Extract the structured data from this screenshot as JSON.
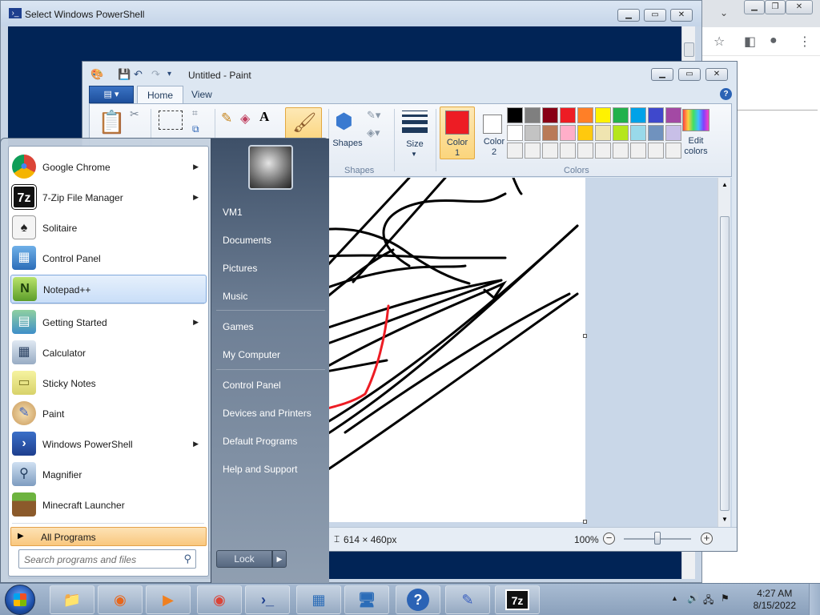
{
  "powershell": {
    "title": "Select Windows PowerShell"
  },
  "paint": {
    "title": "Untitled - Paint",
    "file_tab": "▤ ▾",
    "tabs": [
      {
        "label": "Home",
        "active": true
      },
      {
        "label": "View",
        "active": false
      }
    ],
    "ribbon": {
      "shapes_label": "Shapes",
      "shapes_group": "Shapes",
      "size_label": "Size",
      "color1_label_a": "Color",
      "color1_label_b": "1",
      "color2_label_a": "Color",
      "color2_label_b": "2",
      "colors_group": "Colors",
      "edit_colors_a": "Edit",
      "edit_colors_b": "colors",
      "color1_value": "#ed1c24",
      "color2_value": "#ffffff"
    },
    "palette_row1": [
      "#000000",
      "#7f7f7f",
      "#880015",
      "#ed1c24",
      "#ff7f27",
      "#fff200",
      "#22b14c",
      "#00a2e8",
      "#3f48cc",
      "#a349a4"
    ],
    "palette_row2": [
      "#ffffff",
      "#c3c3c3",
      "#b97a57",
      "#ffaec9",
      "#ffc90e",
      "#efe4b0",
      "#b5e61d",
      "#99d9ea",
      "#7092be",
      "#c8bfe7"
    ],
    "status": {
      "dimensions": "614 × 460px",
      "zoom": "100%"
    }
  },
  "start_menu": {
    "programs": [
      {
        "label": "Google Chrome",
        "icon": "chrome-icon",
        "submenu": true
      },
      {
        "label": "7-Zip File Manager",
        "icon": "7zip-icon",
        "submenu": true
      },
      {
        "label": "Solitaire",
        "icon": "solitaire-icon",
        "submenu": false
      },
      {
        "label": "Control Panel",
        "icon": "control-panel-icon",
        "submenu": false
      },
      {
        "label": "Notepad++",
        "icon": "notepadpp-icon",
        "submenu": false,
        "highlighted": true
      },
      {
        "label": "Getting Started",
        "icon": "getting-started-icon",
        "submenu": true
      },
      {
        "label": "Calculator",
        "icon": "calculator-icon",
        "submenu": false
      },
      {
        "label": "Sticky Notes",
        "icon": "sticky-notes-icon",
        "submenu": false
      },
      {
        "label": "Paint",
        "icon": "paint-icon",
        "submenu": false
      },
      {
        "label": "Windows PowerShell",
        "icon": "powershell-icon",
        "submenu": true
      },
      {
        "label": "Magnifier",
        "icon": "magnifier-icon",
        "submenu": false
      },
      {
        "label": "Minecraft Launcher",
        "icon": "minecraft-icon",
        "submenu": false
      }
    ],
    "all_programs": "All Programs",
    "search_placeholder": "Search programs and files",
    "right_links": [
      "VM1",
      "Documents",
      "Pictures",
      "Music",
      "Games",
      "My Computer",
      "Control Panel",
      "Devices and Printers",
      "Default Programs",
      "Help and Support"
    ],
    "lock_label": "Lock"
  },
  "taskbar": {
    "items": [
      "explorer-icon",
      "firefox-icon",
      "media-player-icon",
      "chrome-icon",
      "powershell-icon",
      "control-panel-icon",
      "remote-desktop-icon",
      "help-icon",
      "paint-icon",
      "7zip-icon"
    ],
    "time": "4:27 AM",
    "date": "8/15/2022"
  }
}
